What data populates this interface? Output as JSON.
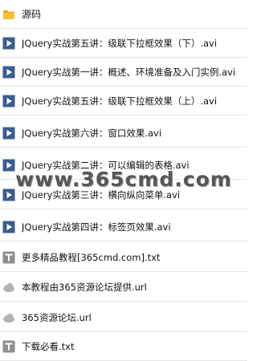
{
  "items": [
    {
      "type": "folder",
      "icon": "folder-icon",
      "name": "源码"
    },
    {
      "type": "video",
      "icon": "video-file-icon",
      "name": "JQuery实战第五讲：级联下拉框效果（下）.avi"
    },
    {
      "type": "video",
      "icon": "video-file-icon",
      "name": "JQuery实战第一讲：概述、环境准备及入门实例.avi"
    },
    {
      "type": "video",
      "icon": "video-file-icon",
      "name": "JQuery实战第五讲：级联下拉框效果（上）.avi"
    },
    {
      "type": "video",
      "icon": "video-file-icon",
      "name": "JQuery实战第六讲：窗口效果.avi"
    },
    {
      "type": "video",
      "icon": "video-file-icon",
      "name": "JQuery实战第二讲：可以编辑的表格.avi"
    },
    {
      "type": "video",
      "icon": "video-file-icon",
      "name": "JQuery实战第三讲：横向纵向菜单.avi"
    },
    {
      "type": "video",
      "icon": "video-file-icon",
      "name": "JQuery实战第四讲：标签页效果.avi"
    },
    {
      "type": "text",
      "icon": "text-file-icon",
      "name": "更多精品教程[365cmd.com].txt"
    },
    {
      "type": "url",
      "icon": "url-file-icon",
      "name": "本教程由365资源论坛提供.url"
    },
    {
      "type": "url",
      "icon": "url-file-icon",
      "name": "365资源论坛.url"
    },
    {
      "type": "text",
      "icon": "text-file-icon",
      "name": "下载必看.txt"
    }
  ],
  "watermark": "www.365cmd.com",
  "colors": {
    "folder": "#f5c13b",
    "video_icon": "#3a5f8f",
    "text_icon": "#8e8e8e",
    "url_icon": "#b4b4b4",
    "row_border": "#e6e6e6"
  }
}
